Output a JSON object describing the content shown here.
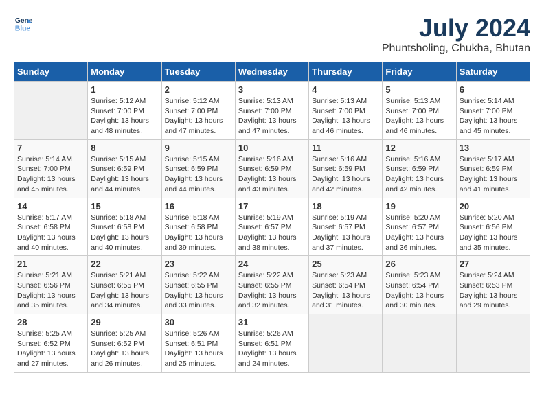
{
  "header": {
    "logo_line1": "General",
    "logo_line2": "Blue",
    "title": "July 2024",
    "subtitle": "Phuntsholing, Chukha, Bhutan"
  },
  "days_of_week": [
    "Sunday",
    "Monday",
    "Tuesday",
    "Wednesday",
    "Thursday",
    "Friday",
    "Saturday"
  ],
  "weeks": [
    [
      {
        "day": "",
        "info": ""
      },
      {
        "day": "1",
        "info": "Sunrise: 5:12 AM\nSunset: 7:00 PM\nDaylight: 13 hours\nand 48 minutes."
      },
      {
        "day": "2",
        "info": "Sunrise: 5:12 AM\nSunset: 7:00 PM\nDaylight: 13 hours\nand 47 minutes."
      },
      {
        "day": "3",
        "info": "Sunrise: 5:13 AM\nSunset: 7:00 PM\nDaylight: 13 hours\nand 47 minutes."
      },
      {
        "day": "4",
        "info": "Sunrise: 5:13 AM\nSunset: 7:00 PM\nDaylight: 13 hours\nand 46 minutes."
      },
      {
        "day": "5",
        "info": "Sunrise: 5:13 AM\nSunset: 7:00 PM\nDaylight: 13 hours\nand 46 minutes."
      },
      {
        "day": "6",
        "info": "Sunrise: 5:14 AM\nSunset: 7:00 PM\nDaylight: 13 hours\nand 45 minutes."
      }
    ],
    [
      {
        "day": "7",
        "info": "Sunrise: 5:14 AM\nSunset: 7:00 PM\nDaylight: 13 hours\nand 45 minutes."
      },
      {
        "day": "8",
        "info": "Sunrise: 5:15 AM\nSunset: 6:59 PM\nDaylight: 13 hours\nand 44 minutes."
      },
      {
        "day": "9",
        "info": "Sunrise: 5:15 AM\nSunset: 6:59 PM\nDaylight: 13 hours\nand 44 minutes."
      },
      {
        "day": "10",
        "info": "Sunrise: 5:16 AM\nSunset: 6:59 PM\nDaylight: 13 hours\nand 43 minutes."
      },
      {
        "day": "11",
        "info": "Sunrise: 5:16 AM\nSunset: 6:59 PM\nDaylight: 13 hours\nand 42 minutes."
      },
      {
        "day": "12",
        "info": "Sunrise: 5:16 AM\nSunset: 6:59 PM\nDaylight: 13 hours\nand 42 minutes."
      },
      {
        "day": "13",
        "info": "Sunrise: 5:17 AM\nSunset: 6:59 PM\nDaylight: 13 hours\nand 41 minutes."
      }
    ],
    [
      {
        "day": "14",
        "info": "Sunrise: 5:17 AM\nSunset: 6:58 PM\nDaylight: 13 hours\nand 40 minutes."
      },
      {
        "day": "15",
        "info": "Sunrise: 5:18 AM\nSunset: 6:58 PM\nDaylight: 13 hours\nand 40 minutes."
      },
      {
        "day": "16",
        "info": "Sunrise: 5:18 AM\nSunset: 6:58 PM\nDaylight: 13 hours\nand 39 minutes."
      },
      {
        "day": "17",
        "info": "Sunrise: 5:19 AM\nSunset: 6:57 PM\nDaylight: 13 hours\nand 38 minutes."
      },
      {
        "day": "18",
        "info": "Sunrise: 5:19 AM\nSunset: 6:57 PM\nDaylight: 13 hours\nand 37 minutes."
      },
      {
        "day": "19",
        "info": "Sunrise: 5:20 AM\nSunset: 6:57 PM\nDaylight: 13 hours\nand 36 minutes."
      },
      {
        "day": "20",
        "info": "Sunrise: 5:20 AM\nSunset: 6:56 PM\nDaylight: 13 hours\nand 35 minutes."
      }
    ],
    [
      {
        "day": "21",
        "info": "Sunrise: 5:21 AM\nSunset: 6:56 PM\nDaylight: 13 hours\nand 35 minutes."
      },
      {
        "day": "22",
        "info": "Sunrise: 5:21 AM\nSunset: 6:55 PM\nDaylight: 13 hours\nand 34 minutes."
      },
      {
        "day": "23",
        "info": "Sunrise: 5:22 AM\nSunset: 6:55 PM\nDaylight: 13 hours\nand 33 minutes."
      },
      {
        "day": "24",
        "info": "Sunrise: 5:22 AM\nSunset: 6:55 PM\nDaylight: 13 hours\nand 32 minutes."
      },
      {
        "day": "25",
        "info": "Sunrise: 5:23 AM\nSunset: 6:54 PM\nDaylight: 13 hours\nand 31 minutes."
      },
      {
        "day": "26",
        "info": "Sunrise: 5:23 AM\nSunset: 6:54 PM\nDaylight: 13 hours\nand 30 minutes."
      },
      {
        "day": "27",
        "info": "Sunrise: 5:24 AM\nSunset: 6:53 PM\nDaylight: 13 hours\nand 29 minutes."
      }
    ],
    [
      {
        "day": "28",
        "info": "Sunrise: 5:25 AM\nSunset: 6:52 PM\nDaylight: 13 hours\nand 27 minutes."
      },
      {
        "day": "29",
        "info": "Sunrise: 5:25 AM\nSunset: 6:52 PM\nDaylight: 13 hours\nand 26 minutes."
      },
      {
        "day": "30",
        "info": "Sunrise: 5:26 AM\nSunset: 6:51 PM\nDaylight: 13 hours\nand 25 minutes."
      },
      {
        "day": "31",
        "info": "Sunrise: 5:26 AM\nSunset: 6:51 PM\nDaylight: 13 hours\nand 24 minutes."
      },
      {
        "day": "",
        "info": ""
      },
      {
        "day": "",
        "info": ""
      },
      {
        "day": "",
        "info": ""
      }
    ]
  ]
}
